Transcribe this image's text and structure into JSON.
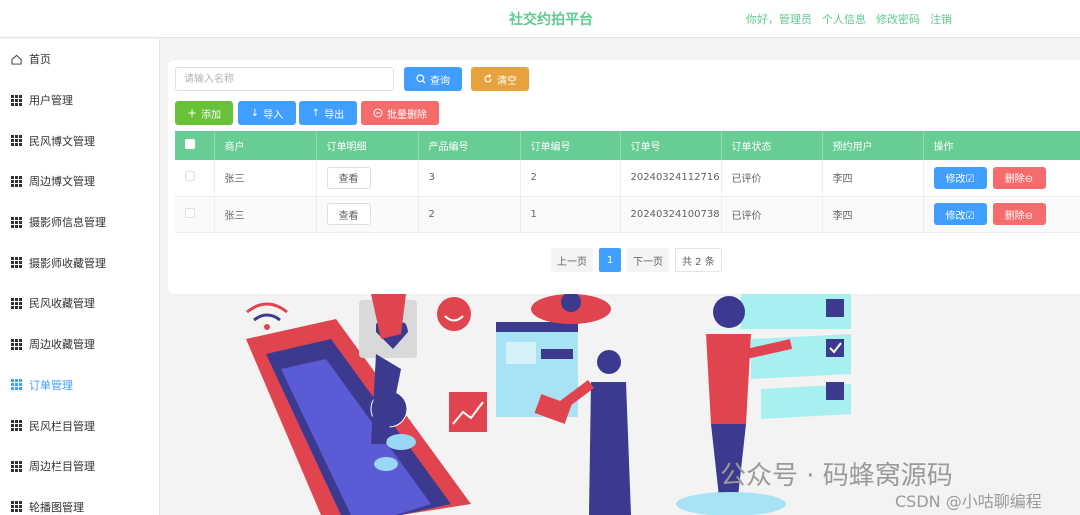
{
  "header": {
    "title": "社交约拍平台",
    "greeting": "你好，管理员",
    "links": [
      "个人信息",
      "修改密码",
      "注销"
    ]
  },
  "sidebar": {
    "items": [
      {
        "label": "首页",
        "icon": "home-icon"
      },
      {
        "label": "用户管理",
        "icon": "grid-icon"
      },
      {
        "label": "民风博文管理",
        "icon": "grid-icon"
      },
      {
        "label": "周边博文管理",
        "icon": "grid-icon"
      },
      {
        "label": "摄影师信息管理",
        "icon": "grid-icon"
      },
      {
        "label": "摄影师收藏管理",
        "icon": "grid-icon"
      },
      {
        "label": "民风收藏管理",
        "icon": "grid-icon"
      },
      {
        "label": "周边收藏管理",
        "icon": "grid-icon"
      },
      {
        "label": "订单管理",
        "icon": "grid-icon",
        "active": true
      },
      {
        "label": "民风栏目管理",
        "icon": "grid-icon"
      },
      {
        "label": "周边栏目管理",
        "icon": "grid-icon"
      },
      {
        "label": "轮播图管理",
        "icon": "grid-icon"
      }
    ]
  },
  "search": {
    "placeholder": "请输入名称",
    "query_label": "查询",
    "clear_label": "清空"
  },
  "toolbar": {
    "add_label": "添加",
    "import_label": "导入",
    "export_label": "导出",
    "batch_delete_label": "批量删除"
  },
  "table": {
    "columns": [
      "商户",
      "订单明细",
      "产品编号",
      "订单编号",
      "订单号",
      "订单状态",
      "预约用户",
      "操作"
    ],
    "rows": [
      {
        "merchant": "张三",
        "detail": "查看",
        "product_no": "3",
        "order_no": "2",
        "order_id": "20240324112716",
        "status": "已评价",
        "user": "李四"
      },
      {
        "merchant": "张三",
        "detail": "查看",
        "product_no": "2",
        "order_no": "1",
        "order_id": "20240324100738",
        "status": "已评价",
        "user": "李四"
      }
    ],
    "edit_label": "修改",
    "delete_label": "删除"
  },
  "pagination": {
    "prev": "上一页",
    "current": "1",
    "next": "下一页",
    "total": "共 2 条"
  },
  "watermark": {
    "line1": "公众号 · 码蜂窝源码",
    "line2": "CSDN @小咕聊编程"
  },
  "colors": {
    "accent_green": "#5fc98f",
    "table_header": "#67cd94",
    "primary_blue": "#409eff",
    "danger_red": "#f56c6c",
    "warning_orange": "#e6a23c",
    "success_green": "#67c23a"
  }
}
